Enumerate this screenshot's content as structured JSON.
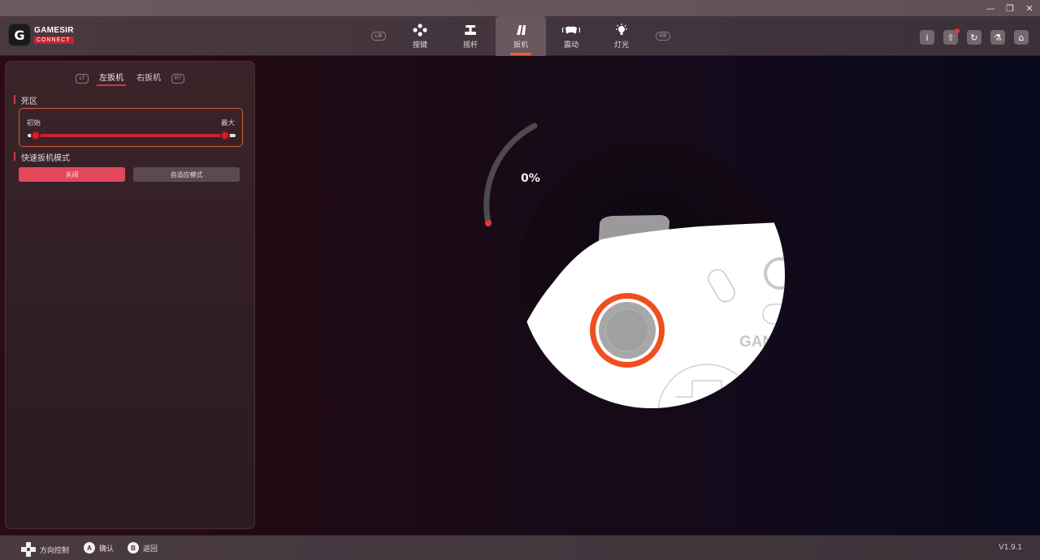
{
  "window_controls": {
    "minimize": "—",
    "restore": "❐",
    "close": "✕"
  },
  "logo": {
    "line1": "GAMESIR",
    "line2": "CONNECT",
    "mark": "G"
  },
  "nav": {
    "lb": "LB",
    "rb": "RB",
    "items": [
      {
        "label": "按键",
        "icon": "gamepad-buttons-icon"
      },
      {
        "label": "摇杆",
        "icon": "joystick-icon"
      },
      {
        "label": "扳机",
        "icon": "trigger-icon",
        "active": true
      },
      {
        "label": "震动",
        "icon": "vibration-icon"
      },
      {
        "label": "灯光",
        "icon": "light-icon"
      }
    ]
  },
  "tools": {
    "info": "i",
    "upload": "⇧",
    "refresh": "↻",
    "lab": "⚗",
    "home": "⌂"
  },
  "trigger_tabs": {
    "lt": "LT",
    "left": "左扳机",
    "right": "右扳机",
    "rt": "RT"
  },
  "deadzone": {
    "title": "死区",
    "start_label": "初始",
    "max_label": "最大",
    "start_value": 0.04,
    "end_value": 0.95
  },
  "fast_trigger": {
    "title": "快速扳机模式",
    "off_label": "关闭",
    "adaptive_label": "自适应模式"
  },
  "visual": {
    "percent": "0%"
  },
  "footer": {
    "dpad_label": "方向控制",
    "a_badge": "A",
    "a_label": "确认",
    "b_badge": "B",
    "b_label": "返回",
    "version": "V1.9.1"
  },
  "colors": {
    "accent": "#e7653e",
    "brand_red": "#c8232f",
    "button_on": "#e3475a"
  }
}
